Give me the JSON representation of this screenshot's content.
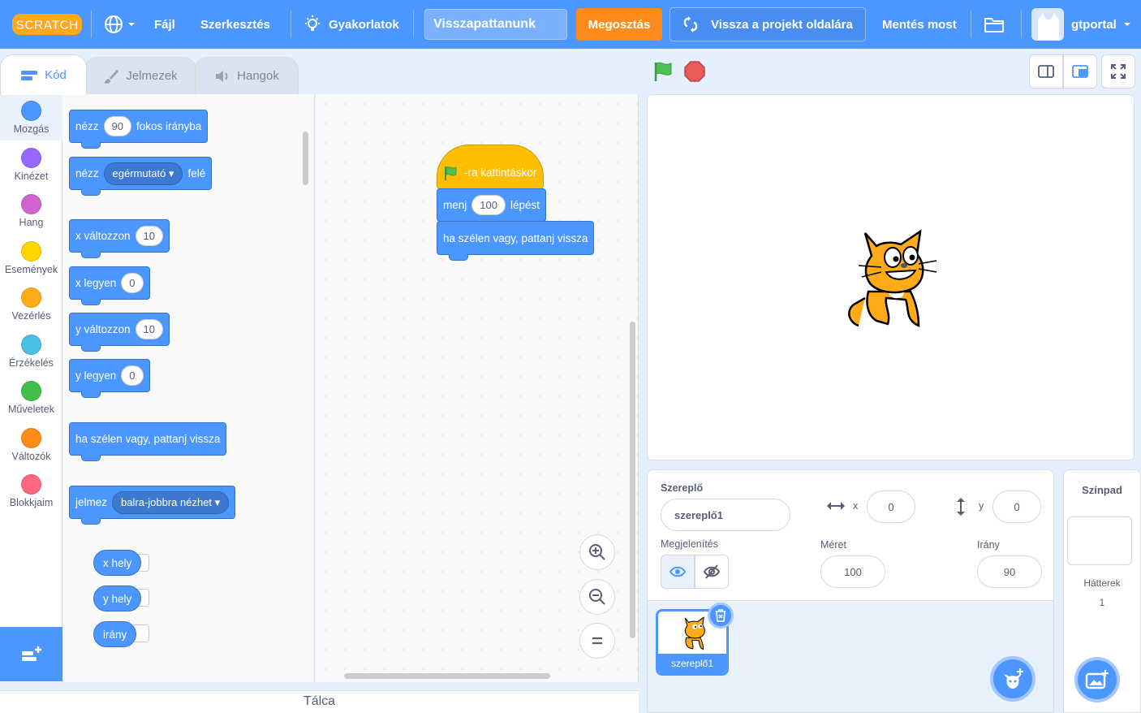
{
  "menubar": {
    "logo_text": "SCRATCH",
    "file": "Fájl",
    "edit": "Szerkesztés",
    "tutorials": "Gyakorlatok",
    "project_title": "Visszapattanunk",
    "share": "Megosztás",
    "see_project": "Vissza a projekt oldalára",
    "save_now": "Mentés most",
    "username": "gtportal"
  },
  "tabs": {
    "code": "Kód",
    "costumes": "Jelmezek",
    "sounds": "Hangok"
  },
  "categories": [
    {
      "label": "Mozgás",
      "color": "#4c97ff"
    },
    {
      "label": "Kinézet",
      "color": "#9966ff"
    },
    {
      "label": "Hang",
      "color": "#cf63cf"
    },
    {
      "label": "Események",
      "color": "#ffd500"
    },
    {
      "label": "Vezérlés",
      "color": "#ffab19"
    },
    {
      "label": "Érzékelés",
      "color": "#4cbfe6"
    },
    {
      "label": "Műveletek",
      "color": "#40bf4a"
    },
    {
      "label": "Változók",
      "color": "#ff8c1a"
    },
    {
      "label": "Blokkjaim",
      "color": "#ff6680"
    }
  ],
  "palette": {
    "point_dir": {
      "pre": "nézz",
      "value": "90",
      "post": "fokos irányba"
    },
    "point_towards": {
      "pre": "nézz",
      "value": "egérmutató",
      "post": "felé"
    },
    "change_x": {
      "pre": "x változzon",
      "value": "10"
    },
    "set_x": {
      "pre": "x legyen",
      "value": "0"
    },
    "change_y": {
      "pre": "y változzon",
      "value": "10"
    },
    "set_y": {
      "pre": "y legyen",
      "value": "0"
    },
    "bounce": "ha szélen vagy, pattanj vissza",
    "rotation": {
      "pre": "jelmez",
      "value": "balra-jobbra nézhet"
    },
    "xpos": "x hely",
    "ypos": "y hely",
    "direction": "irány"
  },
  "script": {
    "hat": "-ra kattintáskor",
    "move": {
      "pre": "menj",
      "value": "100",
      "post": "lépést"
    },
    "bounce": "ha szélen vagy, pattanj vissza"
  },
  "tray": "Tálca",
  "sprite_info": {
    "sprite_label": "Szereplő",
    "sprite_name": "szereplő1",
    "x_label": "x",
    "x_value": "0",
    "y_label": "y",
    "y_value": "0",
    "show_label": "Megjelenítés",
    "size_label": "Méret",
    "size_value": "100",
    "direction_label": "Irány",
    "direction_value": "90"
  },
  "sprite_list": [
    {
      "name": "szereplő1"
    }
  ],
  "stage_pane": {
    "title": "Színpad",
    "backdrops_label": "Hátterek",
    "backdrops_count": "1"
  }
}
